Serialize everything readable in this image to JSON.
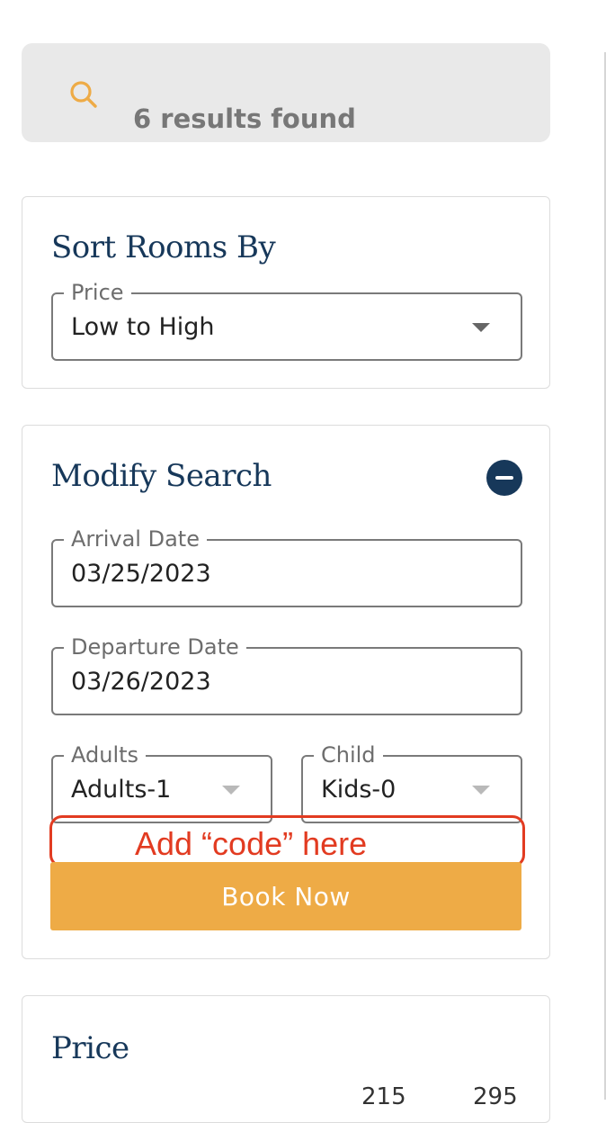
{
  "results": {
    "text": "6 results found",
    "icon": "search-icon",
    "icon_color": "#eeab46"
  },
  "sort": {
    "title": "Sort Rooms By",
    "field_label": "Price",
    "selected": "Low to High"
  },
  "modify": {
    "title": "Modify Search",
    "arrival_label": "Arrival Date",
    "arrival_value": "03/25/2023",
    "departure_label": "Departure Date",
    "departure_value": "03/26/2023",
    "adults_label": "Adults",
    "adults_value": "Adults-1",
    "child_label": "Child",
    "child_value": "Kids-0",
    "annotation": "Add “code” here",
    "book_label": "Book Now"
  },
  "price": {
    "title": "Price",
    "range_min": "215",
    "range_max": "295"
  },
  "colors": {
    "title": "#17385a",
    "accent": "#eeab46",
    "annotation": "#e23b21"
  }
}
